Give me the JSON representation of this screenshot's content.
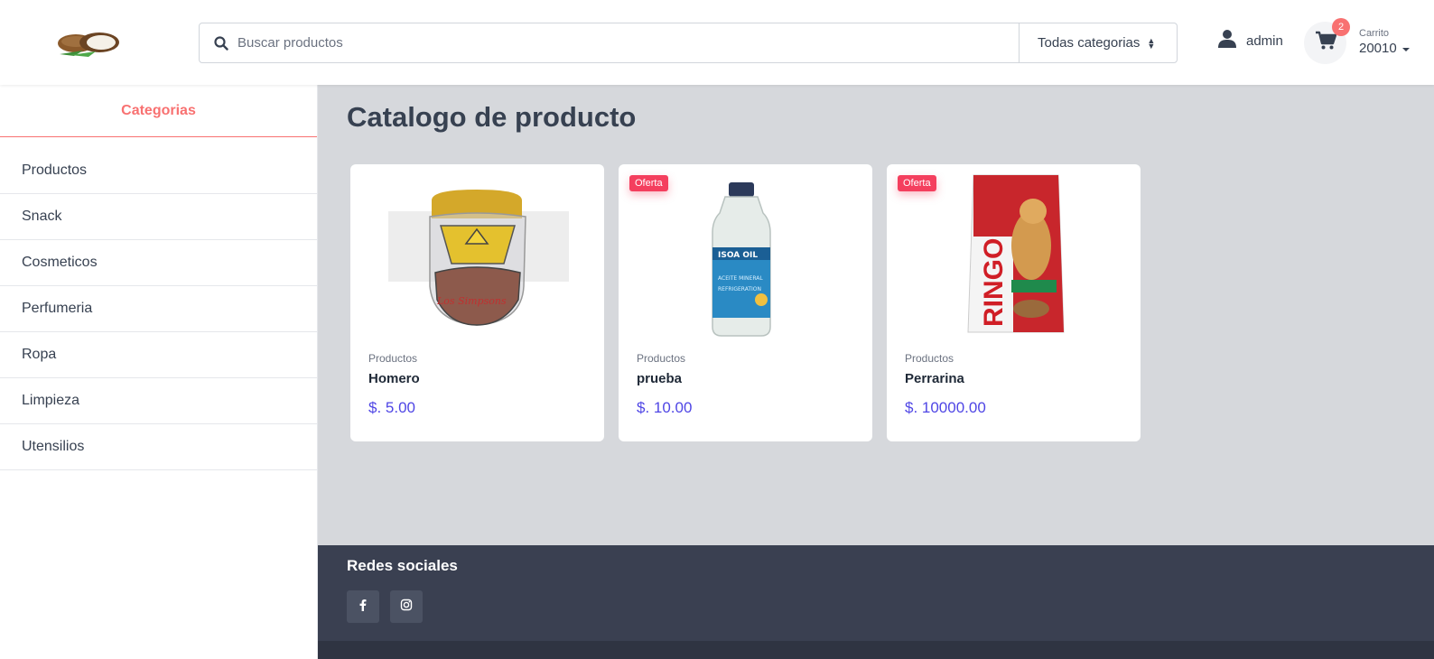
{
  "header": {
    "logo_icon": "coconut-logo-icon",
    "search": {
      "placeholder": "Buscar productos",
      "icon": "search-icon"
    },
    "category_select": {
      "selected": "Todas categorias"
    },
    "user": {
      "name": "admin",
      "icon": "user-icon"
    },
    "cart": {
      "label": "Carrito",
      "value": "20010",
      "count": "2",
      "icon": "cart-icon"
    }
  },
  "sidebar": {
    "title": "Categorias",
    "items": [
      {
        "label": "Productos"
      },
      {
        "label": "Snack"
      },
      {
        "label": "Cosmeticos"
      },
      {
        "label": "Perfumeria"
      },
      {
        "label": "Ropa"
      },
      {
        "label": "Limpieza"
      },
      {
        "label": "Utensilios"
      }
    ]
  },
  "main": {
    "title": "Catalogo de producto",
    "products": [
      {
        "category": "Productos",
        "name": "Homero",
        "price": "$. 5.00",
        "badge": "",
        "image": "face-shield-image"
      },
      {
        "category": "Productos",
        "name": "prueba",
        "price": "$. 10.00",
        "badge": "Oferta",
        "image": "oil-bottle-image"
      },
      {
        "category": "Productos",
        "name": "Perrarina",
        "price": "$. 10000.00",
        "badge": "Oferta",
        "image": "dog-food-bag-image"
      }
    ]
  },
  "footer": {
    "title": "Redes sociales",
    "social": [
      {
        "icon": "facebook-icon"
      },
      {
        "icon": "instagram-icon"
      }
    ]
  },
  "colors": {
    "accent": "#f87171",
    "price": "#4f46e5",
    "badge": "#f43f5e",
    "main_bg": "#d6d8dc",
    "footer_bg": "#3a4051"
  }
}
